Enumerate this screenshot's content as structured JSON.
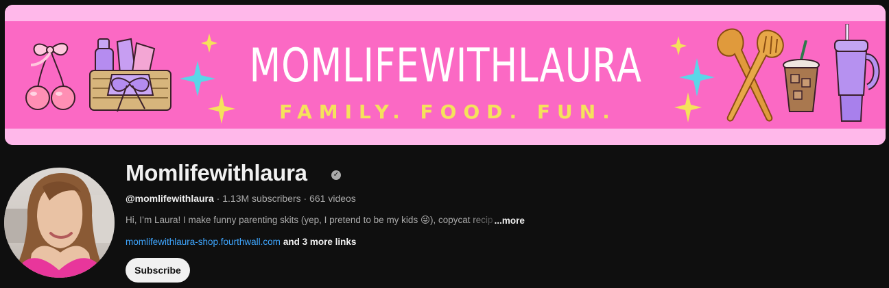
{
  "banner": {
    "title": "MOMLIFEWITHLAURA",
    "tagline": "FAMILY. FOOD. FUN."
  },
  "channel": {
    "name": "Momlifewithlaura",
    "verified_icon": "verified-check-icon",
    "handle": "@momlifewithlaura",
    "separator": " · ",
    "subscribers": "1.13M subscribers",
    "videos": "661 videos",
    "description": "Hi, I’m Laura! I make funny parenting skits (yep, I pretend to be my kids 😜), copycat recip",
    "more_label": "...more",
    "link": "momlifewithlaura-shop.fourthwall.com",
    "more_links": "and 3 more links",
    "subscribe_label": "Subscribe"
  },
  "colors": {
    "background": "#0f0f0f",
    "banner_pink": "#fb69c4",
    "banner_light_pink": "#ffb8ea",
    "tagline_yellow": "#f5e25b",
    "link_blue": "#3ea6ff",
    "secondary_text": "#aaaaaa"
  }
}
